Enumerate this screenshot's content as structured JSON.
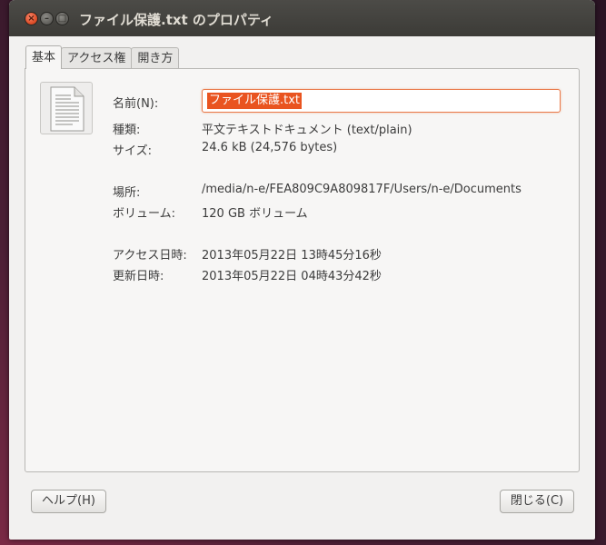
{
  "window": {
    "title": "ファイル保護.txt のプロパティ",
    "close_glyph": "×",
    "minimize_glyph": "–",
    "maximize_glyph": "□"
  },
  "tabs": [
    {
      "label": "基本",
      "active": true
    },
    {
      "label": "アクセス権",
      "active": false
    },
    {
      "label": "開き方",
      "active": false
    }
  ],
  "file_icon": "text-document-icon",
  "fields": {
    "name_label": "名前(N):",
    "name_value": "ファイル保護.txt",
    "type_label": "種類:",
    "type_value": "平文テキストドキュメント (text/plain)",
    "size_label": "サイズ:",
    "size_value": "24.6 kB (24,576 bytes)",
    "location_label": "場所:",
    "location_value": "/media/n-e/FEA809C9A809817F/Users/n-e/Documents",
    "volume_label": "ボリューム:",
    "volume_value": "120 GB ボリューム",
    "accessed_label": "アクセス日時:",
    "accessed_value": "2013年05月22日 13時45分16秒",
    "modified_label": "更新日時:",
    "modified_value": "2013年05月22日 04時43分42秒"
  },
  "buttons": {
    "help": "ヘルプ(H)",
    "close": "閉じる(C)"
  },
  "colors": {
    "accent": "#e95420",
    "titlebar": "#3c3b37",
    "window_bg": "#f2f1f0"
  }
}
